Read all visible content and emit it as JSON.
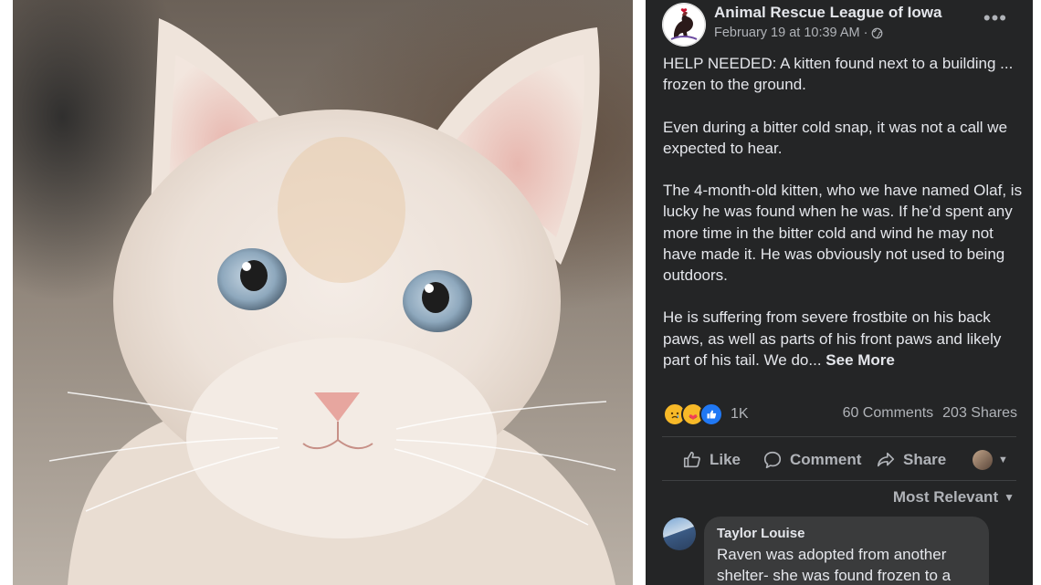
{
  "post": {
    "page_name": "Animal Rescue League of Iowa",
    "date": "February 19 at 10:39 AM",
    "separator": "·",
    "audience_icon": "globe-icon",
    "more_icon": "more-horizontal-icon",
    "paragraphs": [
      "HELP NEEDED: A kitten found next to a building ... frozen to the ground.",
      "Even during a bitter cold snap, it was not a call we expected to hear.",
      "The 4-month-old kitten, who we have named Olaf, is lucky he was found when he was. If he’d spent any more time in the bitter cold and wind he may not have made it. He was obviously not used to being outdoors.",
      "He is suffering from severe frostbite on his back paws, as well as parts of his front paws and likely part of his tail. We do..."
    ],
    "see_more": "See More",
    "reaction_count": "1K",
    "comments_count": "60 Comments",
    "shares_count": "203 Shares",
    "actions": {
      "like": "Like",
      "comment": "Comment",
      "share": "Share"
    },
    "sort_label": "Most Relevant",
    "comment": {
      "author": "Taylor Louise",
      "text": "Raven was adopted from another shelter- she was found frozen to a"
    }
  },
  "colors": {
    "post_bg": "#242526",
    "text_primary": "#e4e6eb",
    "text_secondary": "#b0b3b8",
    "comment_bubble": "#3a3b3c",
    "like_blue": "#2078f4"
  }
}
